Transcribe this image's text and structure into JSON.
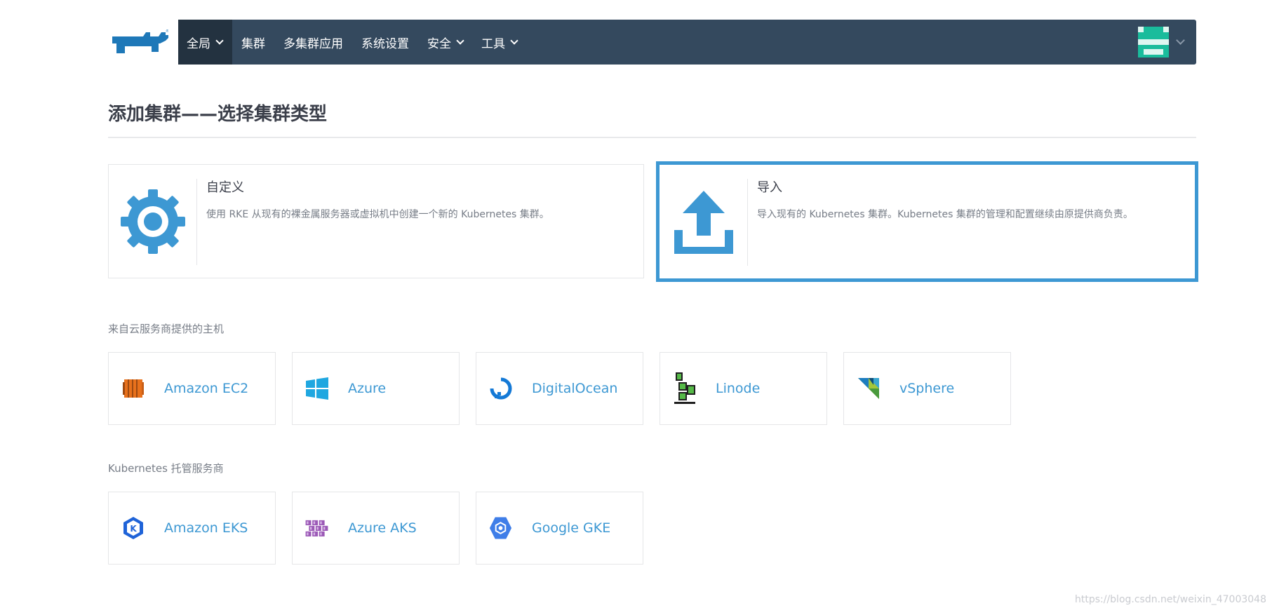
{
  "nav": {
    "items": [
      {
        "label": "全局",
        "dropdown": true,
        "active": true
      },
      {
        "label": "集群",
        "dropdown": false
      },
      {
        "label": "多集群应用",
        "dropdown": false
      },
      {
        "label": "系统设置",
        "dropdown": false
      },
      {
        "label": "安全",
        "dropdown": true
      },
      {
        "label": "工具",
        "dropdown": true
      }
    ]
  },
  "page": {
    "title": "添加集群——选择集群类型"
  },
  "cluster_types": [
    {
      "title": "自定义",
      "description": "使用 RKE 从现有的裸金属服务器或虚拟机中创建一个新的 Kubernetes 集群。",
      "icon": "gear-icon"
    },
    {
      "title": "导入",
      "description": "导入现有的 Kubernetes 集群。Kubernetes 集群的管理和配置继续由原提供商负责。",
      "icon": "upload-icon",
      "selected": true
    }
  ],
  "sections": {
    "cloud_hosts": "来自云服务商提供的主机",
    "hosted_k8s": "Kubernetes 托管服务商"
  },
  "cloud_providers": [
    {
      "label": "Amazon EC2",
      "icon": "amazon-ec2-icon"
    },
    {
      "label": "Azure",
      "icon": "azure-icon"
    },
    {
      "label": "DigitalOcean",
      "icon": "digitalocean-icon"
    },
    {
      "label": "Linode",
      "icon": "linode-icon"
    },
    {
      "label": "vSphere",
      "icon": "vsphere-icon"
    }
  ],
  "hosted_providers": [
    {
      "label": "Amazon EKS",
      "icon": "amazon-eks-icon"
    },
    {
      "label": "Azure AKS",
      "icon": "azure-aks-icon"
    },
    {
      "label": "Google GKE",
      "icon": "google-gke-icon"
    }
  ],
  "colors": {
    "nav_bg": "#34495e",
    "nav_active": "#233240",
    "accent": "#3d98d3",
    "avatar": "#1abc9c"
  },
  "watermark": "https://blog.csdn.net/weixin_47003048"
}
